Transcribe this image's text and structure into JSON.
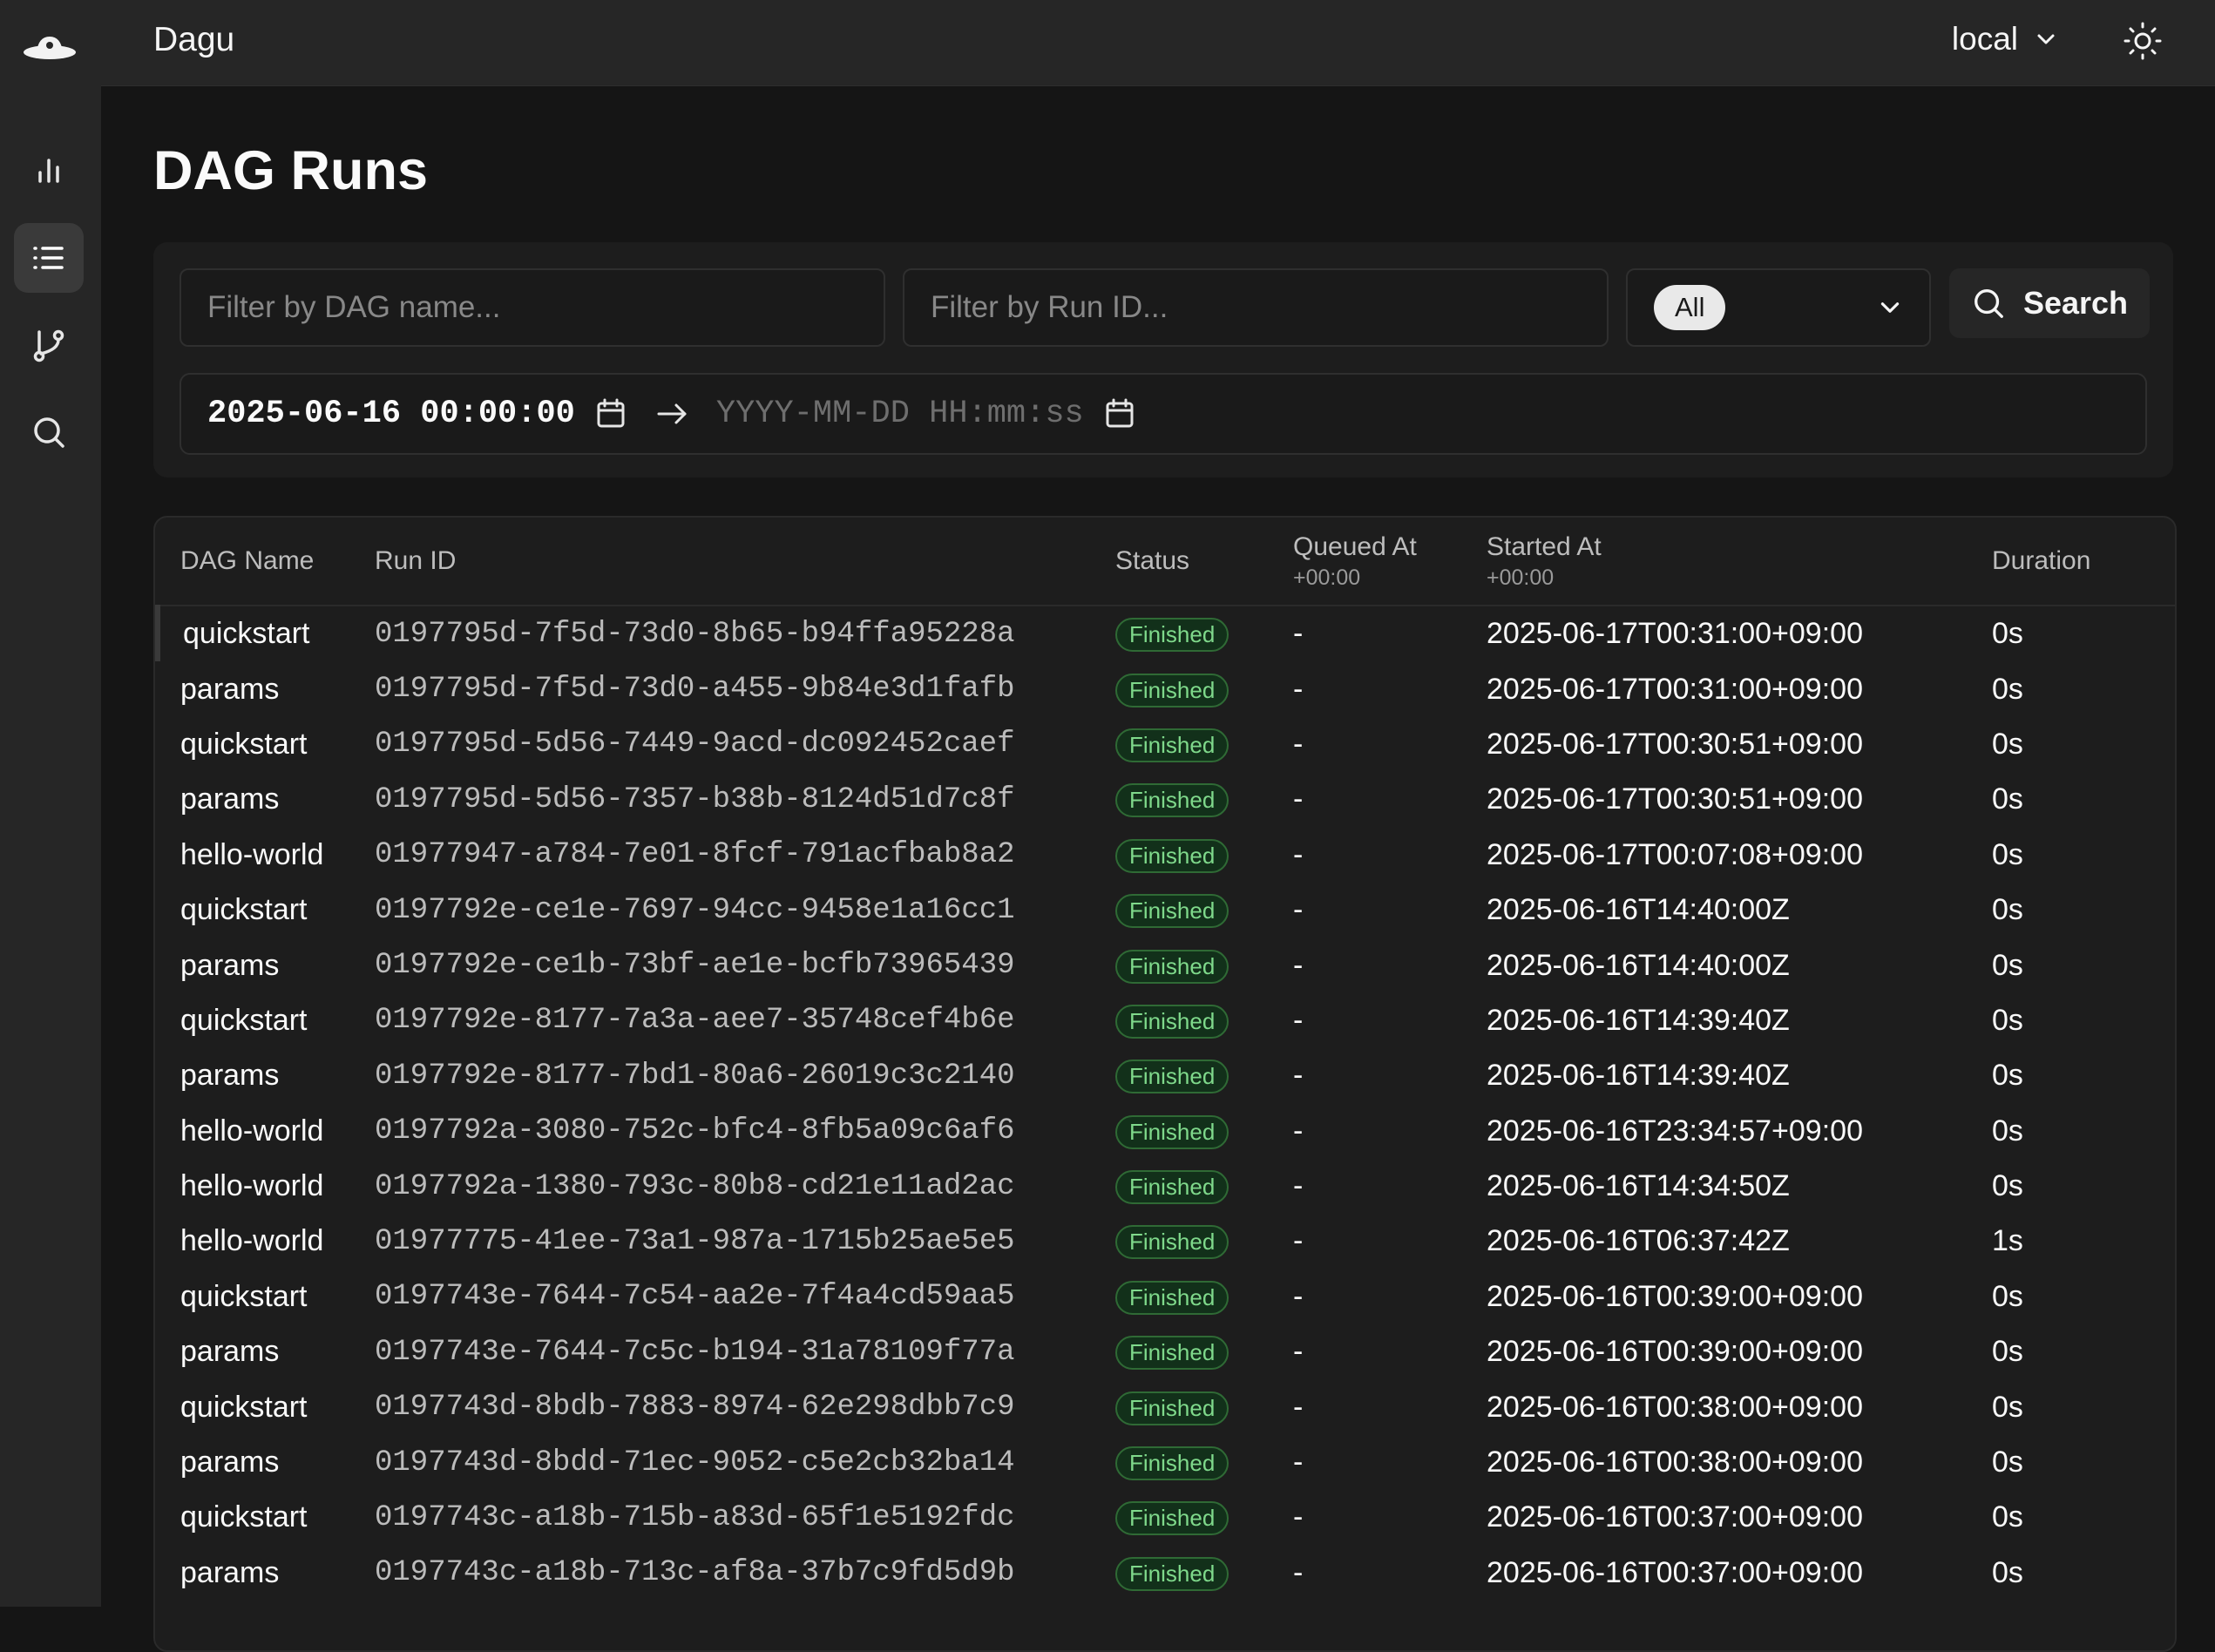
{
  "app": {
    "title": "Dagu",
    "environment": "local"
  },
  "nav": [
    {
      "name": "dashboard",
      "icon": "bar-chart-icon",
      "active": false
    },
    {
      "name": "dag-runs",
      "icon": "list-icon",
      "active": true
    },
    {
      "name": "dag-definitions",
      "icon": "git-branch-icon",
      "active": false
    },
    {
      "name": "search",
      "icon": "search-icon",
      "active": false
    }
  ],
  "page": {
    "title": "DAG Runs"
  },
  "filters": {
    "dag_name_placeholder": "Filter by DAG name...",
    "run_id_placeholder": "Filter by Run ID...",
    "status_value": "All",
    "search_label": "Search",
    "date_start": "2025-06-16 00:00:00",
    "date_end_placeholder": "YYYY-MM-DD HH:mm:ss"
  },
  "table": {
    "columns": {
      "dag_name": "DAG Name",
      "run_id": "Run ID",
      "status": "Status",
      "queued_at": "Queued At",
      "queued_at_tz": "+00:00",
      "started_at": "Started At",
      "started_at_tz": "+00:00",
      "duration": "Duration"
    },
    "rows": [
      {
        "dag": "quickstart",
        "run_id": "0197795d-7f5d-73d0-8b65-b94ffa95228a",
        "status": "Finished",
        "queued": "-",
        "started": "2025-06-17T00:31:00+09:00",
        "duration": "0s"
      },
      {
        "dag": "params",
        "run_id": "0197795d-7f5d-73d0-a455-9b84e3d1fafb",
        "status": "Finished",
        "queued": "-",
        "started": "2025-06-17T00:31:00+09:00",
        "duration": "0s"
      },
      {
        "dag": "quickstart",
        "run_id": "0197795d-5d56-7449-9acd-dc092452caef",
        "status": "Finished",
        "queued": "-",
        "started": "2025-06-17T00:30:51+09:00",
        "duration": "0s"
      },
      {
        "dag": "params",
        "run_id": "0197795d-5d56-7357-b38b-8124d51d7c8f",
        "status": "Finished",
        "queued": "-",
        "started": "2025-06-17T00:30:51+09:00",
        "duration": "0s"
      },
      {
        "dag": "hello-world",
        "run_id": "01977947-a784-7e01-8fcf-791acfbab8a2",
        "status": "Finished",
        "queued": "-",
        "started": "2025-06-17T00:07:08+09:00",
        "duration": "0s"
      },
      {
        "dag": "quickstart",
        "run_id": "0197792e-ce1e-7697-94cc-9458e1a16cc1",
        "status": "Finished",
        "queued": "-",
        "started": "2025-06-16T14:40:00Z",
        "duration": "0s"
      },
      {
        "dag": "params",
        "run_id": "0197792e-ce1b-73bf-ae1e-bcfb73965439",
        "status": "Finished",
        "queued": "-",
        "started": "2025-06-16T14:40:00Z",
        "duration": "0s"
      },
      {
        "dag": "quickstart",
        "run_id": "0197792e-8177-7a3a-aee7-35748cef4b6e",
        "status": "Finished",
        "queued": "-",
        "started": "2025-06-16T14:39:40Z",
        "duration": "0s"
      },
      {
        "dag": "params",
        "run_id": "0197792e-8177-7bd1-80a6-26019c3c2140",
        "status": "Finished",
        "queued": "-",
        "started": "2025-06-16T14:39:40Z",
        "duration": "0s"
      },
      {
        "dag": "hello-world",
        "run_id": "0197792a-3080-752c-bfc4-8fb5a09c6af6",
        "status": "Finished",
        "queued": "-",
        "started": "2025-06-16T23:34:57+09:00",
        "duration": "0s"
      },
      {
        "dag": "hello-world",
        "run_id": "0197792a-1380-793c-80b8-cd21e11ad2ac",
        "status": "Finished",
        "queued": "-",
        "started": "2025-06-16T14:34:50Z",
        "duration": "0s"
      },
      {
        "dag": "hello-world",
        "run_id": "01977775-41ee-73a1-987a-1715b25ae5e5",
        "status": "Finished",
        "queued": "-",
        "started": "2025-06-16T06:37:42Z",
        "duration": "1s"
      },
      {
        "dag": "quickstart",
        "run_id": "0197743e-7644-7c54-aa2e-7f4a4cd59aa5",
        "status": "Finished",
        "queued": "-",
        "started": "2025-06-16T00:39:00+09:00",
        "duration": "0s"
      },
      {
        "dag": "params",
        "run_id": "0197743e-7644-7c5c-b194-31a78109f77a",
        "status": "Finished",
        "queued": "-",
        "started": "2025-06-16T00:39:00+09:00",
        "duration": "0s"
      },
      {
        "dag": "quickstart",
        "run_id": "0197743d-8bdb-7883-8974-62e298dbb7c9",
        "status": "Finished",
        "queued": "-",
        "started": "2025-06-16T00:38:00+09:00",
        "duration": "0s"
      },
      {
        "dag": "params",
        "run_id": "0197743d-8bdd-71ec-9052-c5e2cb32ba14",
        "status": "Finished",
        "queued": "-",
        "started": "2025-06-16T00:38:00+09:00",
        "duration": "0s"
      },
      {
        "dag": "quickstart",
        "run_id": "0197743c-a18b-715b-a83d-65f1e5192fdc",
        "status": "Finished",
        "queued": "-",
        "started": "2025-06-16T00:37:00+09:00",
        "duration": "0s"
      },
      {
        "dag": "params",
        "run_id": "0197743c-a18b-713c-af8a-37b7c9fd5d9b",
        "status": "Finished",
        "queued": "-",
        "started": "2025-06-16T00:37:00+09:00",
        "duration": "0s"
      }
    ]
  },
  "colors": {
    "background": "#151515",
    "sidebar": "#262626",
    "status_finished_text": "#7fd98b",
    "status_finished_border": "#2f6a35"
  }
}
